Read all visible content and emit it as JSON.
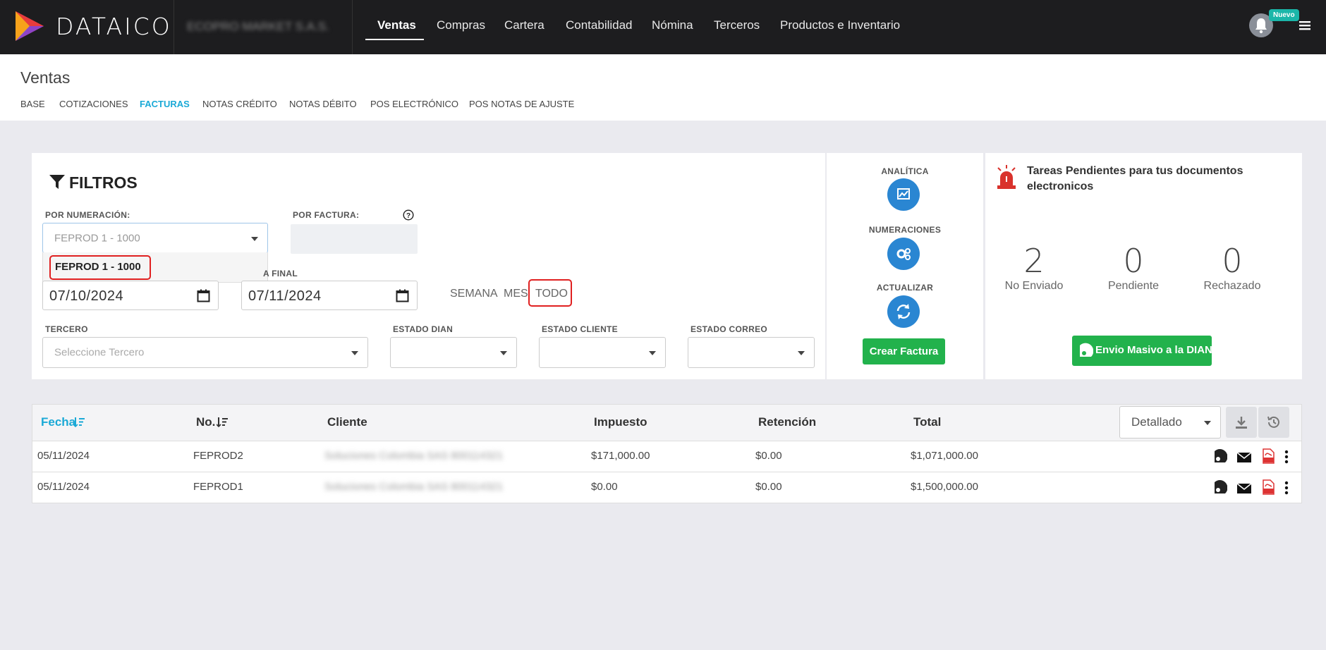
{
  "app": {
    "brand": "DATAICO",
    "company": "ECOPRO MARKET S.A.S.",
    "new_badge": "Nuevo"
  },
  "topnav": [
    "Ventas",
    "Compras",
    "Cartera",
    "Contabilidad",
    "Nómina",
    "Terceros",
    "Productos e Inventario"
  ],
  "page": {
    "title": "Ventas"
  },
  "subtabs": [
    "BASE",
    "COTIZACIONES",
    "FACTURAS",
    "NOTAS CRÉDITO",
    "NOTAS DÉBITO",
    "POS ELECTRÓNICO",
    "POS NOTAS DE AJUSTE"
  ],
  "filters": {
    "title": "FILTROS",
    "numeracion_label": "POR NUMERACIÓN:",
    "numeracion_value": "FEPROD 1 - 1000",
    "numeracion_option": "FEPROD 1 - 1000",
    "factura_label": "POR FACTURA:",
    "fecha_final_label": "A FINAL",
    "fecha_inicial": "07/10/2024",
    "fecha_final": "07/11/2024",
    "quick": [
      "SEMANA",
      "MES",
      "TODO"
    ],
    "tercero_label": "TERCERO",
    "tercero_placeholder": "Seleccione Tercero",
    "estado_dian_label": "ESTADO DIAN",
    "estado_cliente_label": "ESTADO CLIENTE",
    "estado_correo_label": "ESTADO CORREO"
  },
  "actions": {
    "analitica": "ANALÍTICA",
    "numeraciones": "NUMERACIONES",
    "actualizar": "ACTUALIZAR",
    "crear": "Crear Factura"
  },
  "pending": {
    "title": "Tareas Pendientes para tus documentos electronicos",
    "stats": [
      {
        "value": "2",
        "label": "No Enviado"
      },
      {
        "value": "0",
        "label": "Pendiente"
      },
      {
        "value": "0",
        "label": "Rechazado"
      }
    ],
    "button": "Envio Masivo a la DIAN"
  },
  "table": {
    "headers": [
      "Fecha",
      "No.",
      "Cliente",
      "Impuesto",
      "Retención",
      "Total"
    ],
    "view_select": "Detallado",
    "rows": [
      {
        "fecha": "05/11/2024",
        "no": "FEPROD2",
        "cliente": "Soluciones Colombia SAS 800114321",
        "impuesto": "$171,000.00",
        "retencion": "$0.00",
        "total": "$1,071,000.00"
      },
      {
        "fecha": "05/11/2024",
        "no": "FEPROD1",
        "cliente": "Soluciones Colombia SAS 800114321",
        "impuesto": "$0.00",
        "retencion": "$0.00",
        "total": "$1,500,000.00"
      }
    ]
  }
}
